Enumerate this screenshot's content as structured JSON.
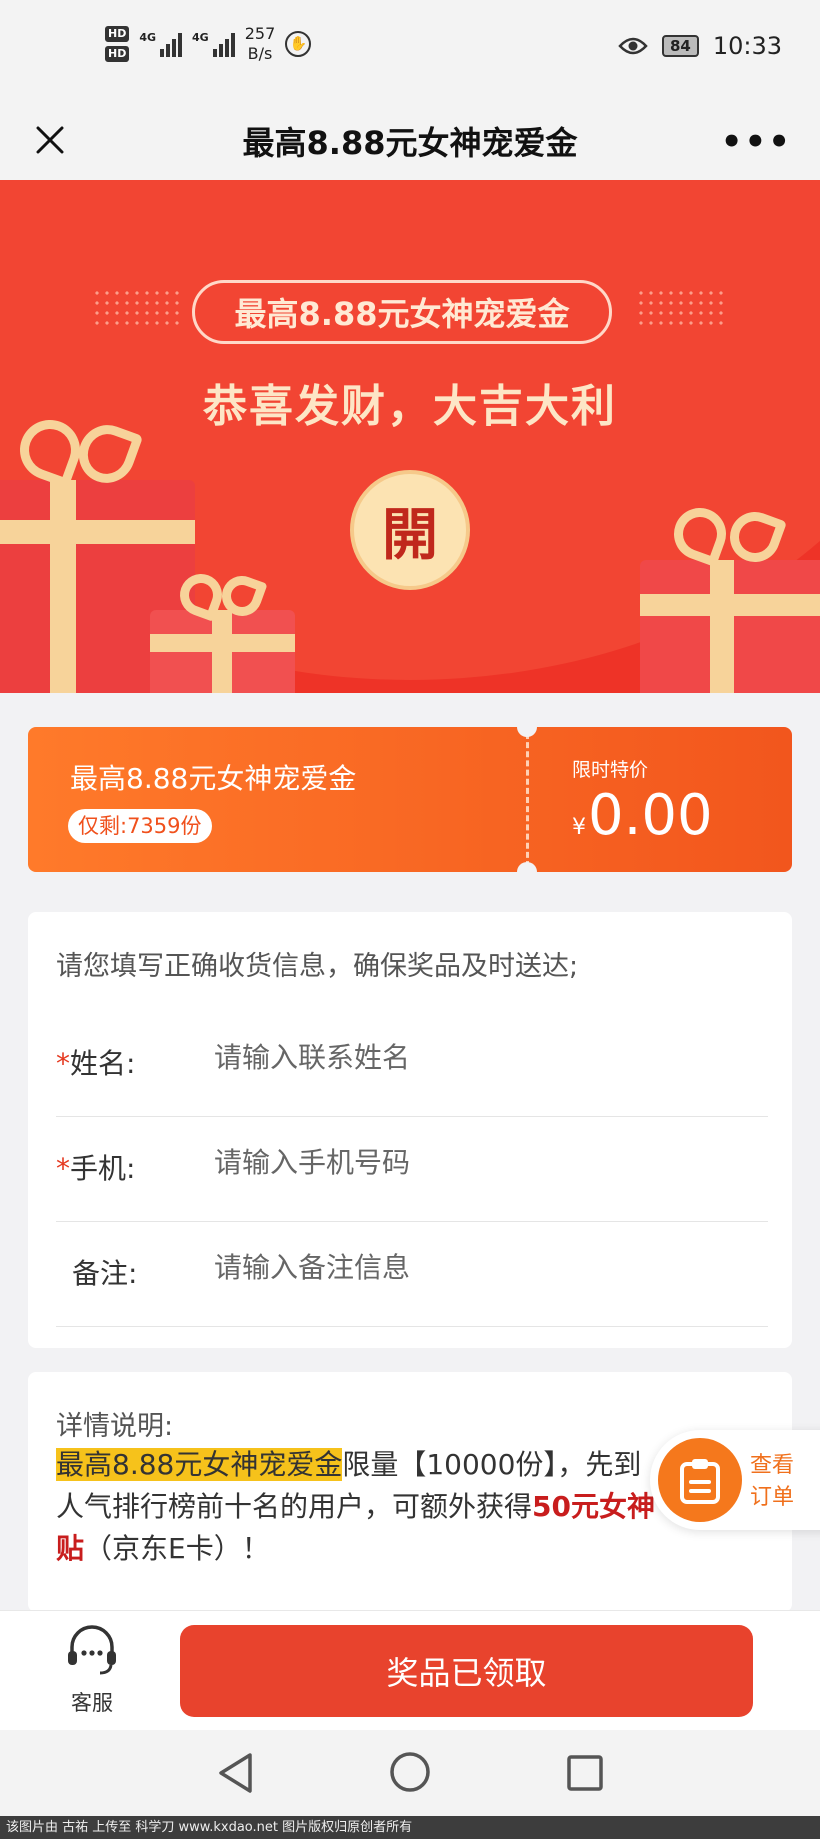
{
  "status_bar": {
    "hd1": "HD",
    "hd2": "HD",
    "signal1": "4G",
    "signal2": "4G",
    "speed_value": "257",
    "speed_unit": "B/s",
    "battery": "84",
    "time": "10:33"
  },
  "nav": {
    "title": "最高8.88元女神宠爱金",
    "more": "•••"
  },
  "hero": {
    "pill_text": "最高8.88元女神宠爱金",
    "slogan": "恭喜发财，大吉大利",
    "open_char": "開"
  },
  "coupon": {
    "title": "最高8.88元女神宠爱金",
    "remaining": "仅剩:7359份",
    "price_label": "限时特价",
    "currency": "¥",
    "price": "0.00"
  },
  "form": {
    "intro": "请您填写正确收货信息，确保奖品及时送达;",
    "required_mark": "*",
    "name_label": "姓名:",
    "name_placeholder": "请输入联系姓名",
    "phone_label": "手机:",
    "phone_placeholder": "请输入手机号码",
    "note_label": "备注:",
    "note_placeholder": "请输入备注信息"
  },
  "details": {
    "title": "详情说明:",
    "highlight": "最高8.88元女神宠爱金",
    "text_a": "限量【10000份】，先到",
    "text_b": "人气排行榜前十名的用户，可额外获得",
    "bold_red_a": "50元女神",
    "bold_red_b": "贴",
    "text_c": "（京东E卡）！"
  },
  "floating": {
    "line1": "查看",
    "line2": "订单"
  },
  "bottom": {
    "service_label": "客服",
    "claim_label": "奖品已领取"
  },
  "watermark": "该图片由 古祐 上传至 科学刀 www.kxdao.net 图片版权归原创者所有",
  "colors": {
    "hero_red": "#ee3327",
    "coupon_orange": "#f2561d",
    "claim_red": "#e8432d",
    "highlight_yellow": "#f6c21b"
  }
}
